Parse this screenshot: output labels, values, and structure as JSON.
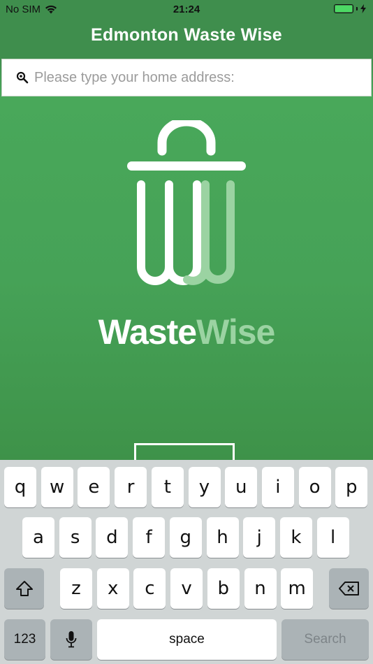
{
  "status_bar": {
    "carrier": "No SIM",
    "time": "21:24",
    "battery_level": 1.0
  },
  "header": {
    "title": "Edmonton Waste Wise"
  },
  "search": {
    "placeholder": "Please type your home address:",
    "value": ""
  },
  "logo": {
    "text_part1": "Waste",
    "text_part2": "Wise"
  },
  "colors": {
    "primary_green": "#47a356",
    "header_green": "#3f8e4d",
    "logo_accent": "#9bd3a2"
  },
  "keyboard": {
    "row1": [
      "q",
      "w",
      "e",
      "r",
      "t",
      "y",
      "u",
      "i",
      "o",
      "p"
    ],
    "row2": [
      "a",
      "s",
      "d",
      "f",
      "g",
      "h",
      "j",
      "k",
      "l"
    ],
    "row3": [
      "z",
      "x",
      "c",
      "v",
      "b",
      "n",
      "m"
    ],
    "numbers_label": "123",
    "space_label": "space",
    "search_label": "Search"
  }
}
